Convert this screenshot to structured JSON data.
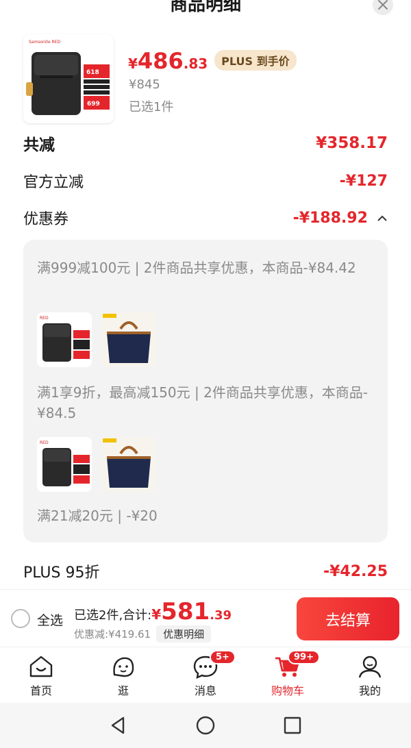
{
  "sheet": {
    "title": "商品明细",
    "product": {
      "price_yen": "¥",
      "price_int": "486",
      "price_dec": ".83",
      "plus_badge": "PLUS 到手价",
      "original_price": "¥845",
      "selected_count": "已选1件"
    }
  },
  "detail": {
    "total_label": "共减",
    "total_value": "¥358.17",
    "official_label": "官方立减",
    "official_value": "-¥127",
    "coupon_label": "优惠券",
    "coupon_value": "-¥188.92",
    "coupons": [
      {
        "text": "满999减100元 | 2件商品共享优惠，本商品-¥84.42"
      },
      {
        "text": "满1享9折，最高减150元 | 2件商品共享优惠，本商品-¥84.5"
      },
      {
        "text": "满21减20元 | -¥20"
      }
    ],
    "plus_label": "PLUS 95折",
    "plus_value": "-¥42.25"
  },
  "checkout": {
    "select_all": "全选",
    "summary_label": "已选2件,合计:",
    "total_yen": "¥",
    "total_int": "581",
    "total_dec": ".39",
    "discount_text": "优惠减:¥419.61",
    "discount_detail_button": "优惠明细",
    "pay_button": "去结算"
  },
  "tabbar": {
    "home": "首页",
    "browse": "逛",
    "messages": "消息",
    "messages_badge": "5+",
    "cart": "购物车",
    "cart_badge": "99+",
    "mine": "我的"
  },
  "colors": {
    "accent": "#e4262c",
    "plus_badge_bg": "#f7e5cc"
  }
}
